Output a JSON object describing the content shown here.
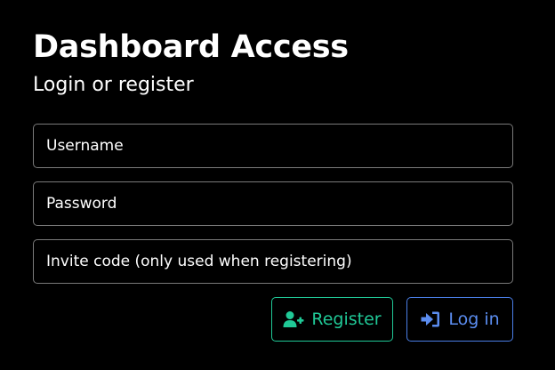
{
  "header": {
    "title": "Dashboard Access",
    "subtitle": "Login or register"
  },
  "form": {
    "username_placeholder": "Username",
    "password_placeholder": "Password",
    "invite_placeholder": "Invite code (only used when registering)"
  },
  "actions": {
    "register_label": "Register",
    "register_icon": "user-plus-icon",
    "register_color": "#20c997",
    "login_label": "Log in",
    "login_icon": "sign-in-icon",
    "login_color": "#5b8df0"
  }
}
